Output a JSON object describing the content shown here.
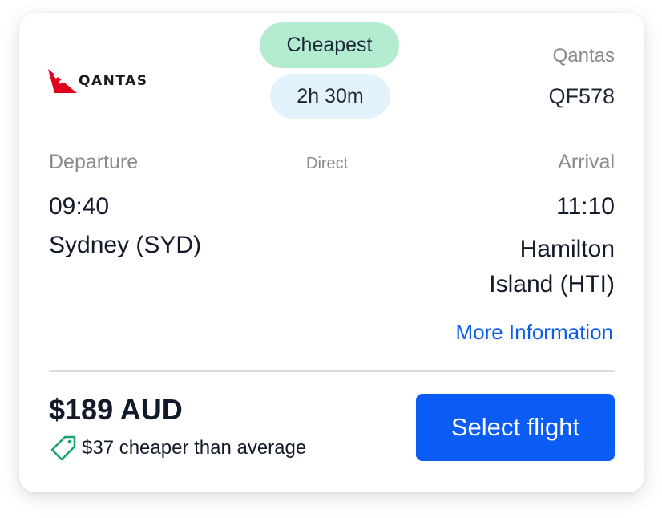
{
  "logo": {
    "text": "QANTAS",
    "icon": "kangaroo-tail-icon",
    "brand_color": "#e0001b"
  },
  "badges": {
    "cheapest": "Cheapest",
    "duration": "2h 30m"
  },
  "airline": {
    "name": "Qantas",
    "flight_number": "QF578"
  },
  "route": {
    "departure_label": "Departure",
    "arrival_label": "Arrival",
    "stops": "Direct",
    "departure_time": "09:40",
    "arrival_time": "11:10",
    "departure_city": "Sydney (SYD)",
    "arrival_city": "Hamilton Island (HTI)"
  },
  "more_info": "More Information",
  "pricing": {
    "price": "$189 AUD",
    "savings": "$37 cheaper than average",
    "savings_icon": "price-tag-icon",
    "savings_color": "#1aa36b"
  },
  "actions": {
    "select": "Select flight"
  },
  "colors": {
    "accent": "#0a5cf5",
    "cheapest_badge": "#b4ecd2",
    "duration_badge": "#e3f3fb",
    "text_dark": "#121a2a",
    "text_muted": "#8a8a8a"
  }
}
